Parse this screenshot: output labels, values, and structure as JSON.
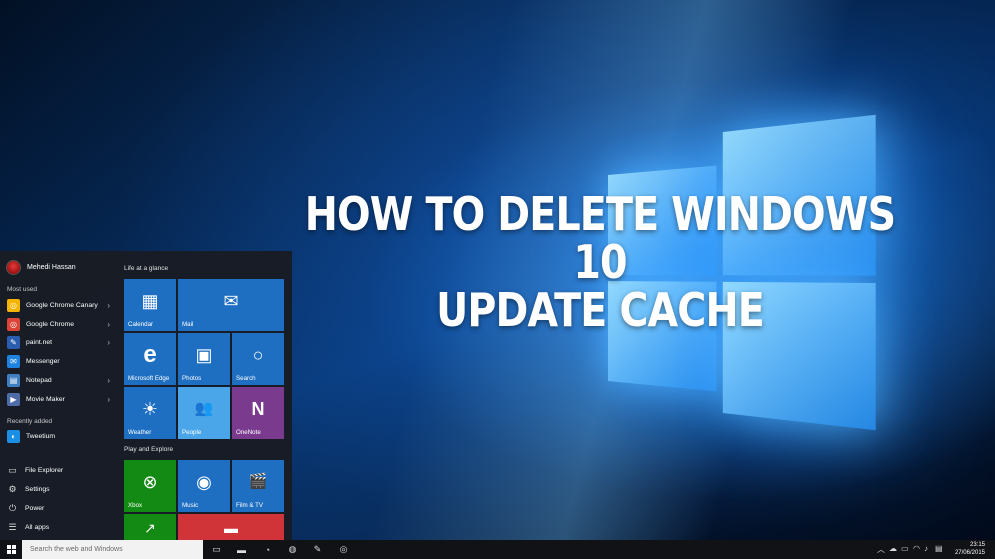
{
  "headline": {
    "line1": "HOW TO DELETE WINDOWS 10",
    "line2": "UPDATE CACHE"
  },
  "start_menu": {
    "user_name": "Mehedi Hassan",
    "most_used_label": "Most used",
    "most_used": [
      {
        "label": "Google Chrome Canary",
        "icon": "chrome-canary-icon",
        "color": "#f5b400",
        "glyph": "◎",
        "has_arrow": true
      },
      {
        "label": "Google Chrome",
        "icon": "chrome-icon",
        "color": "#db4437",
        "glyph": "◎",
        "has_arrow": true
      },
      {
        "label": "paint.net",
        "icon": "paint-net-icon",
        "color": "#2a5db0",
        "glyph": "✎",
        "has_arrow": true
      },
      {
        "label": "Messenger",
        "icon": "messenger-icon",
        "color": "#1d82e0",
        "glyph": "✉",
        "has_arrow": false
      },
      {
        "label": "Notepad",
        "icon": "notepad-icon",
        "color": "#3f7fc0",
        "glyph": "▤",
        "has_arrow": true
      },
      {
        "label": "Movie Maker",
        "icon": "movie-maker-icon",
        "color": "#4d6ca8",
        "glyph": "▶",
        "has_arrow": true
      }
    ],
    "recently_added_label": "Recently added",
    "recently_added": [
      {
        "label": "Tweetium",
        "icon": "tweetium-icon",
        "color": "#1a8fe3",
        "glyph": "◐"
      }
    ],
    "system": [
      {
        "label": "File Explorer",
        "icon": "file-explorer-icon",
        "glyph": "▭"
      },
      {
        "label": "Settings",
        "icon": "settings-icon",
        "glyph": "⚙"
      },
      {
        "label": "Power",
        "icon": "power-icon",
        "glyph": "⏻"
      },
      {
        "label": "All apps",
        "icon": "all-apps-icon",
        "glyph": "☰"
      }
    ],
    "group1_label": "Life at a glance",
    "group2_label": "Play and Explore",
    "tiles": {
      "calendar": {
        "label": "Calendar",
        "glyph": "▦",
        "color": "#1e6fc2"
      },
      "mail": {
        "label": "Mail",
        "glyph": "✉",
        "color": "#1e6fc2"
      },
      "edge": {
        "label": "Microsoft Edge",
        "glyph": "e",
        "color": "#1e6fc2"
      },
      "photos": {
        "label": "Photos",
        "glyph": "▣",
        "color": "#1e6fc2"
      },
      "search": {
        "label": "Search",
        "glyph": "○",
        "color": "#1e6fc2"
      },
      "weather": {
        "label": "Weather",
        "glyph": "☀",
        "color": "#1e6fc2"
      },
      "people": {
        "label": "People",
        "glyph": "👥",
        "color": "#4aa6e8"
      },
      "onenote": {
        "label": "OneNote",
        "glyph": "N",
        "color": "#7a3b8f"
      },
      "xbox": {
        "label": "Xbox",
        "glyph": "⊗",
        "color": "#138a13"
      },
      "music": {
        "label": "Music",
        "glyph": "◉",
        "color": "#1e6fc2"
      },
      "film": {
        "label": "Film & TV",
        "glyph": "🎬",
        "color": "#1e6fc2"
      },
      "money": {
        "label": "",
        "glyph": "↗",
        "color": "#138a13"
      },
      "news": {
        "label": "",
        "glyph": "▬",
        "color": "#d13438"
      }
    }
  },
  "taskbar": {
    "search_placeholder": "Search the web and Windows",
    "pinned": [
      {
        "icon": "task-view-icon",
        "glyph": "▭"
      },
      {
        "icon": "file-explorer-icon",
        "glyph": "▬"
      },
      {
        "icon": "messenger-icon",
        "glyph": "◔"
      },
      {
        "icon": "spotify-icon",
        "glyph": "◍"
      },
      {
        "icon": "paint-net-icon",
        "glyph": "✎"
      },
      {
        "icon": "chrome-canary-icon",
        "glyph": "◎"
      }
    ],
    "clock_time": "23:15",
    "clock_date": "27/06/2015"
  }
}
